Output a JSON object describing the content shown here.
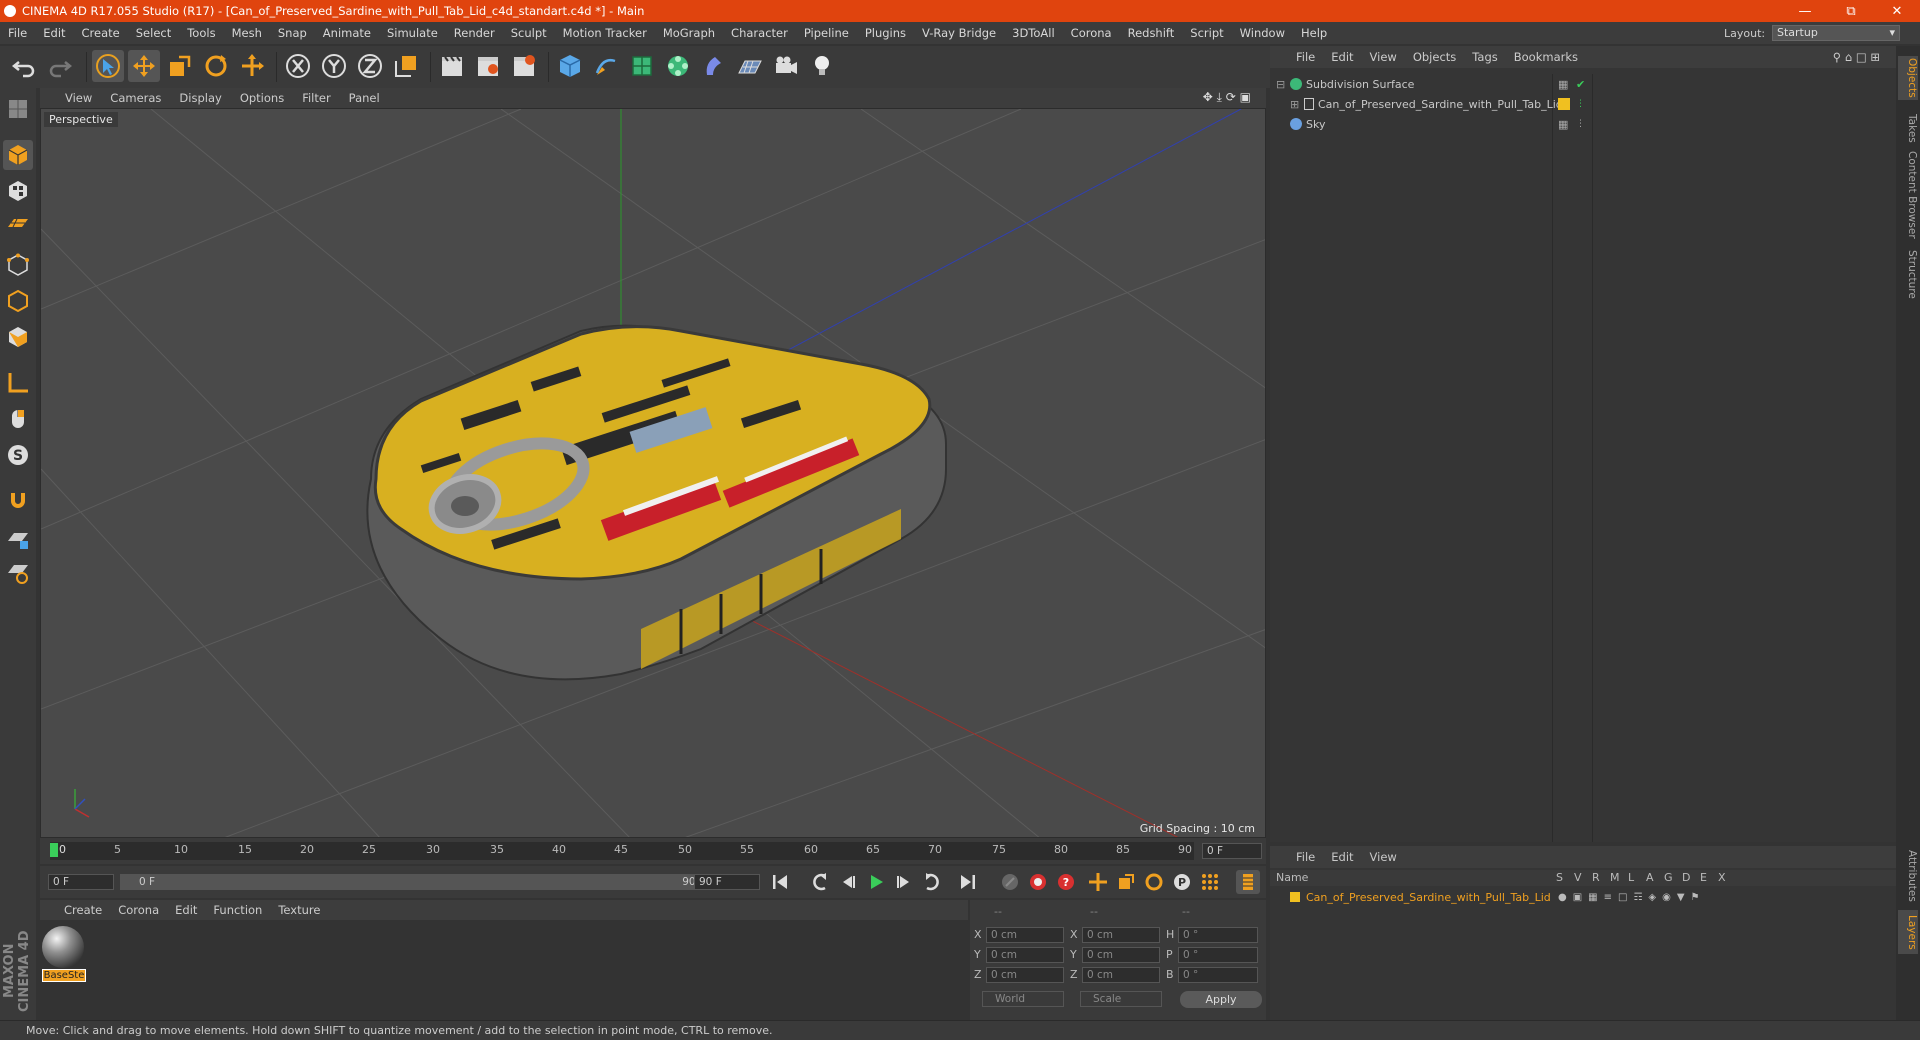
{
  "window": {
    "title": "CINEMA 4D R17.055 Studio (R17) - [Can_of_Preserved_Sardine_with_Pull_Tab_Lid_c4d_standart.c4d *] - Main"
  },
  "menu": [
    "File",
    "Edit",
    "Create",
    "Select",
    "Tools",
    "Mesh",
    "Snap",
    "Animate",
    "Simulate",
    "Render",
    "Sculpt",
    "Motion Tracker",
    "MoGraph",
    "Character",
    "Pipeline",
    "Plugins",
    "V-Ray Bridge",
    "3DToAll",
    "Corona",
    "Redshift",
    "Script",
    "Window",
    "Help"
  ],
  "layout": {
    "label": "Layout:",
    "value": "Startup"
  },
  "viewport": {
    "menu": [
      "View",
      "Cameras",
      "Display",
      "Options",
      "Filter",
      "Panel"
    ],
    "label": "Perspective",
    "grid_spacing": "Grid Spacing : 10 cm"
  },
  "timeline": {
    "ticks": [
      "0",
      "5",
      "10",
      "15",
      "20",
      "25",
      "30",
      "35",
      "40",
      "45",
      "50",
      "55",
      "60",
      "65",
      "70",
      "75",
      "80",
      "85",
      "90"
    ],
    "current": "0 F",
    "start": "0 F",
    "range_start": "0 F",
    "range_end": "90 F",
    "end": "90 F"
  },
  "materials": {
    "menu": [
      "Create",
      "Corona",
      "Edit",
      "Function",
      "Texture"
    ],
    "items": [
      {
        "name": "BaseSte"
      }
    ]
  },
  "coords": {
    "headers": [
      "--",
      "--",
      "--"
    ],
    "rows": [
      {
        "a": "X",
        "av": "0 cm",
        "b": "X",
        "bv": "0 cm",
        "c": "H",
        "cv": "0 °"
      },
      {
        "a": "Y",
        "av": "0 cm",
        "b": "Y",
        "bv": "0 cm",
        "c": "P",
        "cv": "0 °"
      },
      {
        "a": "Z",
        "av": "0 cm",
        "b": "Z",
        "bv": "0 cm",
        "c": "B",
        "cv": "0 °"
      }
    ],
    "space": "World",
    "mode": "Scale",
    "apply": "Apply"
  },
  "objects": {
    "menu": [
      "File",
      "Edit",
      "View",
      "Objects",
      "Tags",
      "Bookmarks"
    ],
    "items": [
      {
        "name": "Subdivision Surface"
      },
      {
        "name": "Can_of_Preserved_Sardine_with_Pull_Tab_Lid"
      },
      {
        "name": "Sky"
      }
    ]
  },
  "layers": {
    "menu": [
      "File",
      "Edit",
      "View"
    ],
    "name_header": "Name",
    "cols": [
      "S",
      "V",
      "R",
      "M",
      "L",
      "A",
      "G",
      "D",
      "E",
      "X"
    ],
    "items": [
      {
        "name": "Can_of_Preserved_Sardine_with_Pull_Tab_Lid"
      }
    ]
  },
  "right_tabs": [
    "Objects",
    "Takes",
    "Content Browser",
    "Structure"
  ],
  "right_tabs_bottom": [
    "Attributes",
    "Layers"
  ],
  "brand": "MAXON CINEMA 4D",
  "status": "Move: Click and drag to move elements. Hold down SHIFT to quantize movement / add to the selection in point mode, CTRL to remove.",
  "colors": {
    "title_bar": "#e0440e",
    "accent": "#f0a020",
    "layer_yellow": "#f0c020"
  }
}
